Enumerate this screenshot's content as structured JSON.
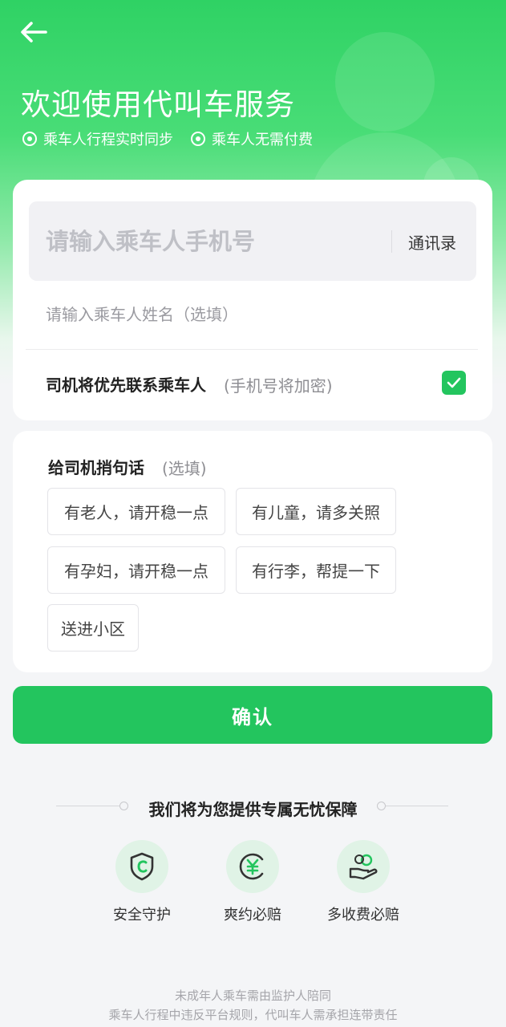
{
  "header": {
    "title": "欢迎使用代叫车服务",
    "features": [
      "乘车人行程实时同步",
      "乘车人无需付费"
    ]
  },
  "passenger_form": {
    "phone_placeholder": "请输入乘车人手机号",
    "contacts_label": "通讯录",
    "name_placeholder": "请输入乘车人姓名（选填）",
    "priority_label": "司机将优先联系乘车人",
    "priority_sub": "(手机号将加密)",
    "priority_checked": true
  },
  "driver_message": {
    "title": "给司机捎句话",
    "optional": "(选填)",
    "chips": [
      "有老人，请开稳一点",
      "有儿童，请多关照",
      "有孕妇，请开稳一点",
      "有行李，帮提一下",
      "送进小区"
    ]
  },
  "confirm_label": "确认",
  "guarantee": {
    "title": "我们将为您提供专属无忧保障",
    "items": [
      {
        "label": "安全守护",
        "icon": "shield-icon"
      },
      {
        "label": "爽约必赔",
        "icon": "yuan-coin-icon"
      },
      {
        "label": "多收费必赔",
        "icon": "hand-coin-icon"
      }
    ]
  },
  "footer": {
    "lines": [
      "未成年人乘车需由监护人陪同",
      "乘车人行程中违反平台规则，代叫车人需承担连带责任"
    ]
  },
  "colors": {
    "brand_green": "#23c55e",
    "hero_green": "#2fd264"
  }
}
